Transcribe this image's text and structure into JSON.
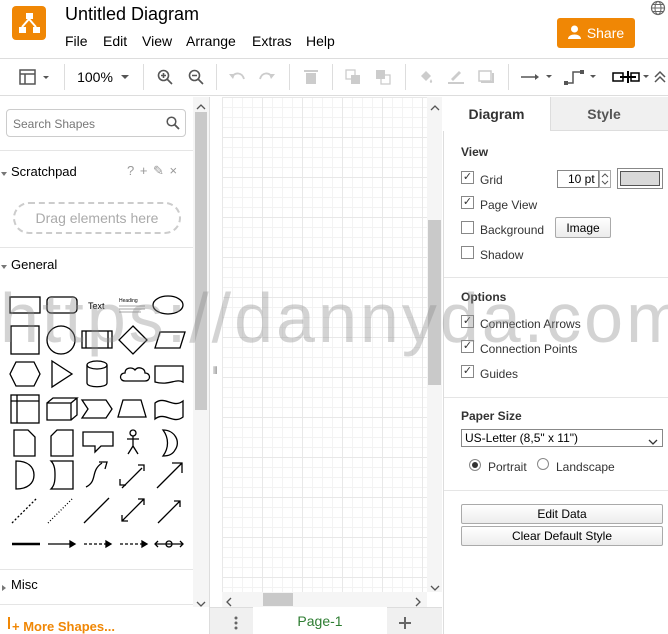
{
  "app": {
    "title": "Untitled Diagram",
    "share_label": "Share",
    "menu": [
      "File",
      "Edit",
      "View",
      "Arrange",
      "Extras",
      "Help"
    ]
  },
  "toolbar": {
    "zoom": "100%"
  },
  "left": {
    "search_placeholder": "Search Shapes",
    "scratchpad_title": "Scratchpad",
    "scratchpad_tools": "? + ✎ ×",
    "drag_hint": "Drag elements here",
    "general_title": "General",
    "misc_title": "Misc",
    "more_shapes": "More Shapes...",
    "text_shape": "Text",
    "heading_shape": "Heading"
  },
  "pages": {
    "current": "Page-1"
  },
  "right": {
    "tabs": [
      "Diagram",
      "Style"
    ],
    "view_title": "View",
    "grid_label": "Grid",
    "grid_size": "10 pt",
    "page_view_label": "Page View",
    "background_label": "Background",
    "image_button": "Image",
    "shadow_label": "Shadow",
    "options_title": "Options",
    "connection_arrows": "Connection Arrows",
    "connection_points": "Connection Points",
    "guides": "Guides",
    "paper_size_title": "Paper Size",
    "paper_size": "US-Letter (8,5\" x 11\")",
    "portrait": "Portrait",
    "landscape": "Landscape",
    "edit_data": "Edit Data",
    "clear_style": "Clear Default Style"
  },
  "checks": {
    "grid": true,
    "page_view": true,
    "background": false,
    "shadow": false,
    "connection_arrows": true,
    "connection_points": true,
    "guides": true
  },
  "colors": {
    "accent": "#f08705",
    "page_tab": "#2e7d32"
  },
  "watermark": "https://dannyda.com"
}
